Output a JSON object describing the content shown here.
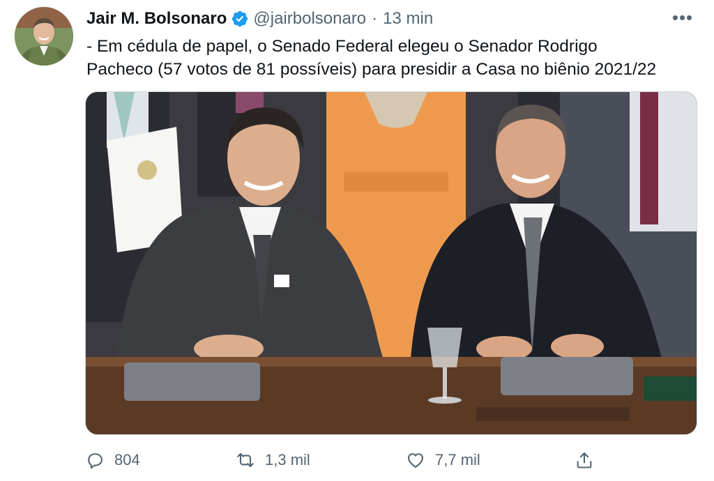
{
  "tweet": {
    "author_name": "Jair M. Bolsonaro",
    "handle": "@jairbolsonaro",
    "separator": "·",
    "time": "13 min",
    "more_label": "•••",
    "text_lines": [
      "- Em cédula de papel, o Senado Federal elegeu o Senador Rodrigo",
      "Pacheco (57 votos de 81 possíveis) para presidir a Casa no biênio 2021/22"
    ],
    "verified_icon": "verified-badge-icon",
    "accent_color": "#1d9bf0"
  },
  "actions": {
    "reply": {
      "icon": "reply-icon",
      "count": "804"
    },
    "retweet": {
      "icon": "retweet-icon",
      "count": "1,3 mil"
    },
    "like": {
      "icon": "heart-icon",
      "count": "7,7 mil"
    },
    "share": {
      "icon": "share-icon"
    }
  },
  "colors": {
    "text": "#0f1419",
    "secondary": "#536471",
    "border": "#cfd9de"
  }
}
